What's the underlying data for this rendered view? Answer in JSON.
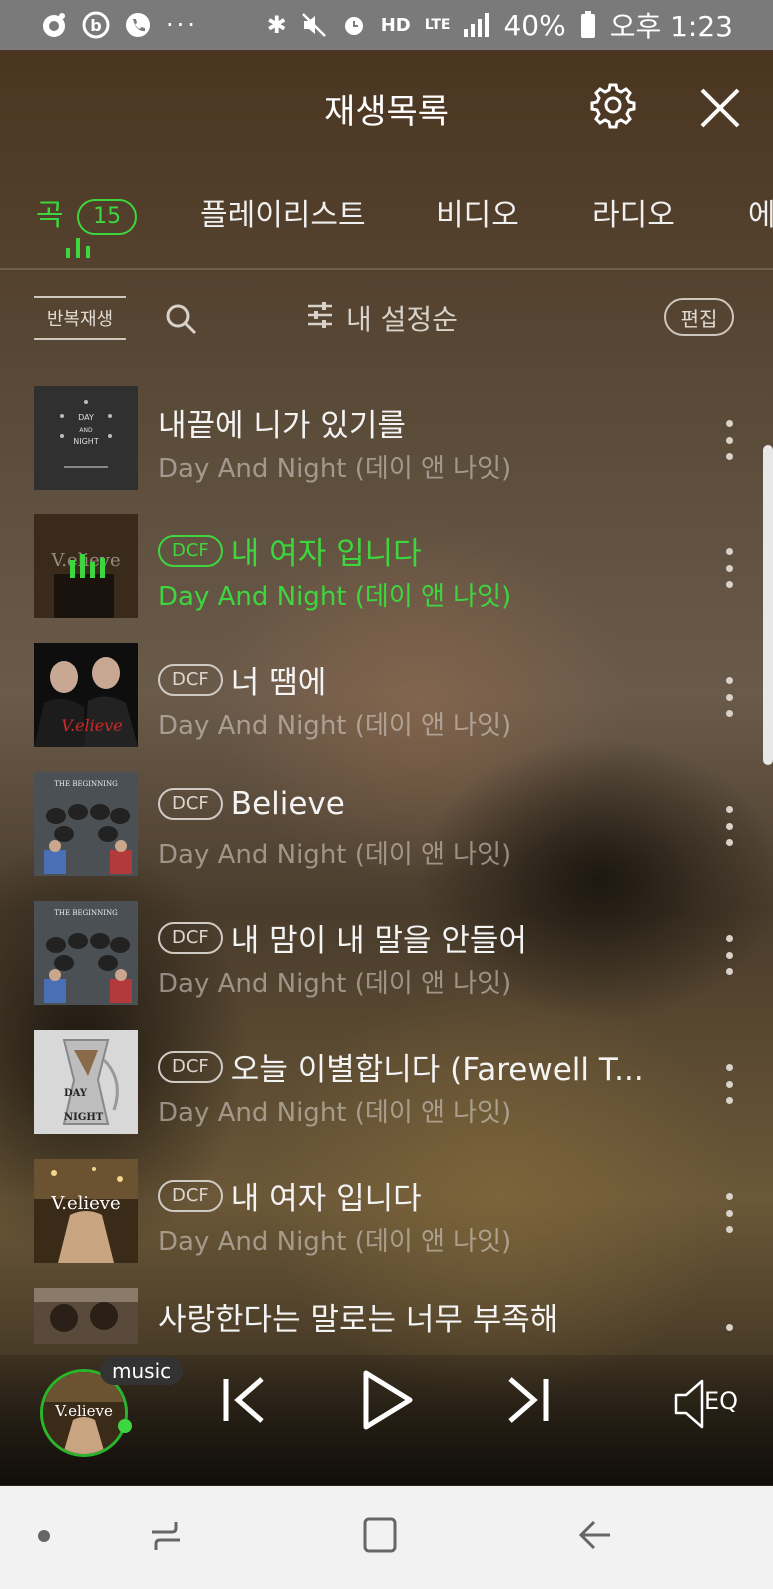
{
  "status_bar": {
    "battery": "40%",
    "time": "오후 1:23",
    "hd": "HD",
    "lte": "LTE"
  },
  "header": {
    "title": "재생목록"
  },
  "tabs": [
    {
      "label": "곡",
      "count": "15",
      "active": true
    },
    {
      "label": "플레이리스트"
    },
    {
      "label": "비디오"
    },
    {
      "label": "라디오"
    },
    {
      "label": "에"
    }
  ],
  "toolbar": {
    "repeat_label": "반복재생",
    "sort_label": "내 설정순",
    "edit_label": "편집"
  },
  "songs": [
    {
      "title": "내끝에 니가 있기를",
      "artist": "Day And Night (데이 앤 나잇)",
      "dcf": false,
      "playing": false
    },
    {
      "title": "내 여자 입니다",
      "artist": "Day And Night (데이 앤 나잇)",
      "dcf": true,
      "playing": true
    },
    {
      "title": "너 땜에",
      "artist": "Day And Night (데이 앤 나잇)",
      "dcf": true,
      "playing": false
    },
    {
      "title": "Believe",
      "artist": "Day And Night (데이 앤 나잇)",
      "dcf": true,
      "playing": false
    },
    {
      "title": "내 맘이 내 말을 안들어",
      "artist": "Day And Night (데이 앤 나잇)",
      "dcf": true,
      "playing": false
    },
    {
      "title": "오늘 이별합니다 (Farewell T...",
      "artist": "Day And Night (데이 앤 나잇)",
      "dcf": true,
      "playing": false
    },
    {
      "title": "내 여자 입니다",
      "artist": "Day And Night (데이 앤 나잇)",
      "dcf": true,
      "playing": false
    },
    {
      "title": "사랑한다는 말로는 너무 부족해",
      "artist": "",
      "dcf": false,
      "playing": false
    }
  ],
  "dcf_label": "DCF",
  "album_art_text": {
    "day_and_night": [
      "DAY",
      "AND",
      "NIGHT"
    ],
    "velieve": "V.elieve",
    "beginning": "THE BEGINNING"
  },
  "player": {
    "badge": "music",
    "disc_text": "V.elieve",
    "eq_label": "EQ"
  },
  "colors": {
    "accent": "#3ed63e",
    "status_bar": "#7a7a7a",
    "nav_bar": "#f2f2f2"
  }
}
